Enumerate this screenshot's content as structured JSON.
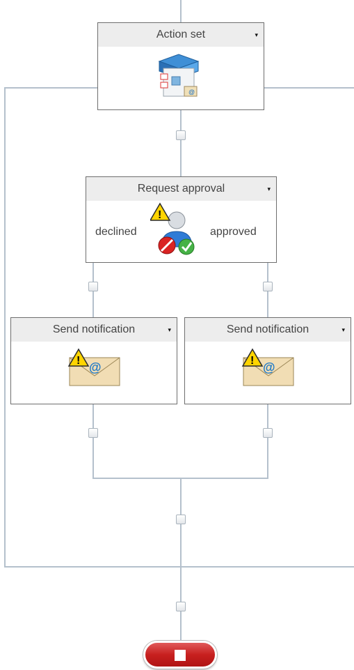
{
  "actions": {
    "action_set": {
      "title": "Action set",
      "menu_glyph": "▾"
    },
    "request_approval": {
      "title": "Request approval",
      "menu_glyph": "▾",
      "branch_left": "declined",
      "branch_right": "approved"
    },
    "send_notification_left": {
      "title": "Send notification",
      "menu_glyph": "▾"
    },
    "send_notification_right": {
      "title": "Send notification",
      "menu_glyph": "▾"
    }
  },
  "icons": {
    "action_set": "action-set-box-icon",
    "request_approval": "approval-user-warning-icon",
    "send_notification": "email-envelope-warning-icon",
    "end": "stop-icon"
  },
  "colors": {
    "connector": "#b4c0cc",
    "header_bg": "#ededed",
    "end_button": "#c8201f",
    "warning": "#ffd400"
  }
}
